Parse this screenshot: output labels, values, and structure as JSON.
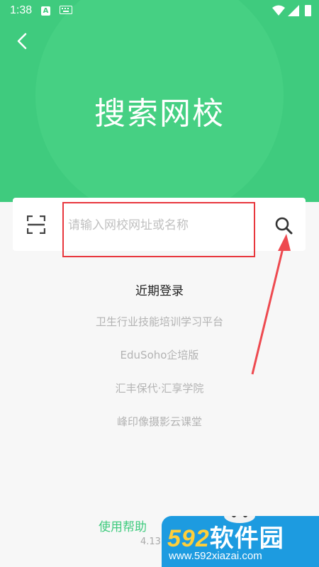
{
  "status_bar": {
    "time": "1:38",
    "notification_letter": "A"
  },
  "header": {
    "title": "搜索网校",
    "background_color": "#3fcb7e"
  },
  "search": {
    "placeholder": "请输入网校网址或名称",
    "value": ""
  },
  "recent": {
    "title": "近期登录",
    "items": [
      "卫生行业技能培训学习平台",
      "EduSoho企培版",
      "汇丰保代·汇享学院",
      "峰印像摄影云课堂"
    ]
  },
  "footer": {
    "help_label": "使用帮助",
    "version": "4.13"
  },
  "watermark": {
    "number": "592",
    "brand": "软件园",
    "url": "www.592xiazai.com"
  },
  "colors": {
    "accent": "#3fcb7e",
    "highlight": "#e8373d",
    "watermark_bg": "#1d9be0"
  }
}
